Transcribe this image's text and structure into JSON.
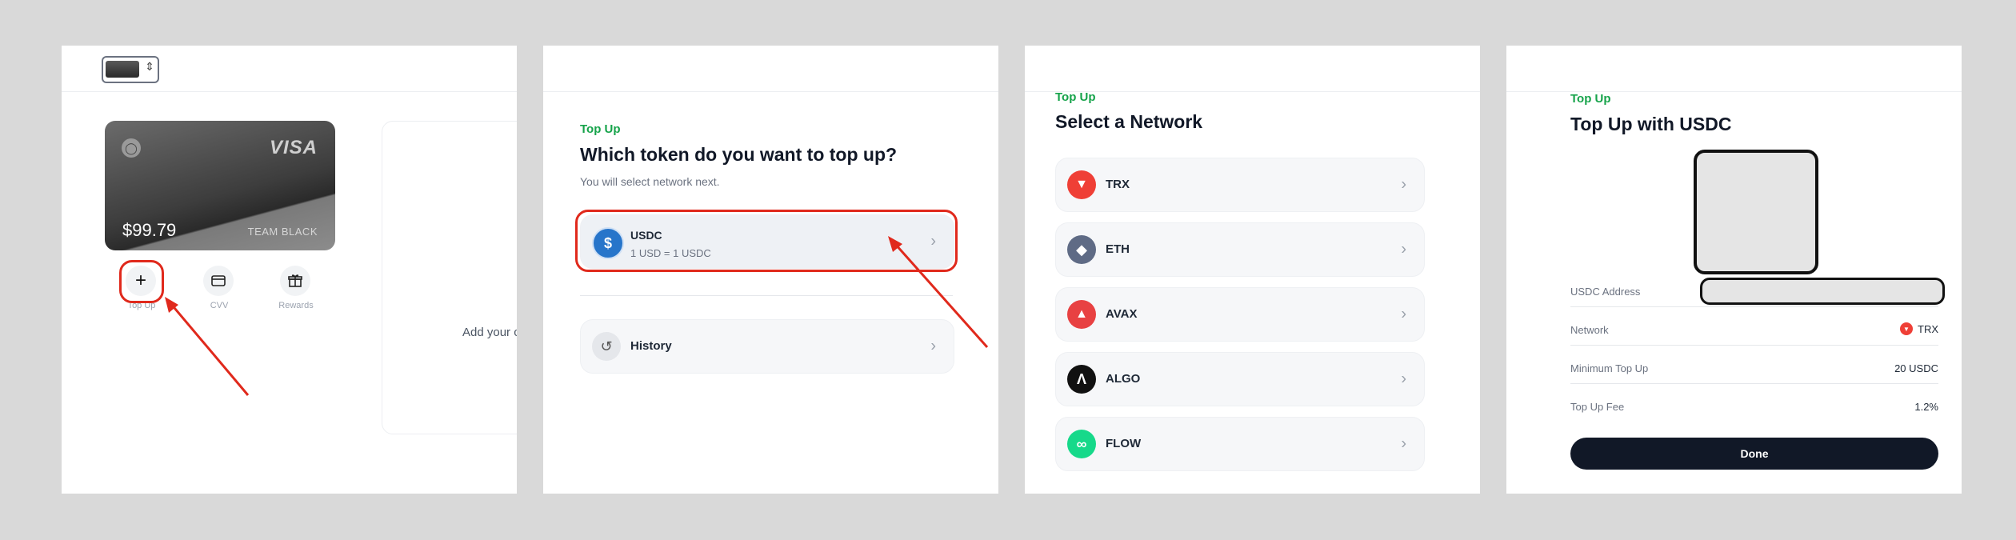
{
  "panel1": {
    "card": {
      "balance": "$99.79",
      "brand": "VISA",
      "team": "TEAM BLACK"
    },
    "actions": [
      {
        "label": "Top Up",
        "icon": "plus-icon"
      },
      {
        "label": "CVV",
        "icon": "card-icon"
      },
      {
        "label": "Rewards",
        "icon": "gift-icon"
      }
    ],
    "side_text": "Add your c"
  },
  "panel2": {
    "eyebrow": "Top Up",
    "title": "Which token do you want to top up?",
    "subtitle": "You will select network next.",
    "token": {
      "name": "USDC",
      "rate": "1 USD = 1 USDC"
    },
    "history_label": "History"
  },
  "panel3": {
    "eyebrow": "Top Up",
    "title": "Select a Network",
    "networks": [
      {
        "name": "TRX",
        "color": "#ef3f36"
      },
      {
        "name": "ETH",
        "color": "#5f6b85"
      },
      {
        "name": "AVAX",
        "color": "#e84142"
      },
      {
        "name": "ALGO",
        "color": "#111111"
      },
      {
        "name": "FLOW",
        "color": "#16d98a"
      }
    ]
  },
  "panel4": {
    "eyebrow": "Top Up",
    "title": "Top Up with USDC",
    "details": [
      {
        "label": "USDC Address",
        "value": ""
      },
      {
        "label": "Network",
        "value": "TRX"
      },
      {
        "label": "Minimum Top Up",
        "value": "20 USDC"
      },
      {
        "label": "Top Up Fee",
        "value": "1.2%"
      }
    ],
    "done_label": "Done"
  },
  "colors": {
    "accent_green": "#16a34a",
    "annotation_red": "#e0291c",
    "done_button": "#111827"
  }
}
